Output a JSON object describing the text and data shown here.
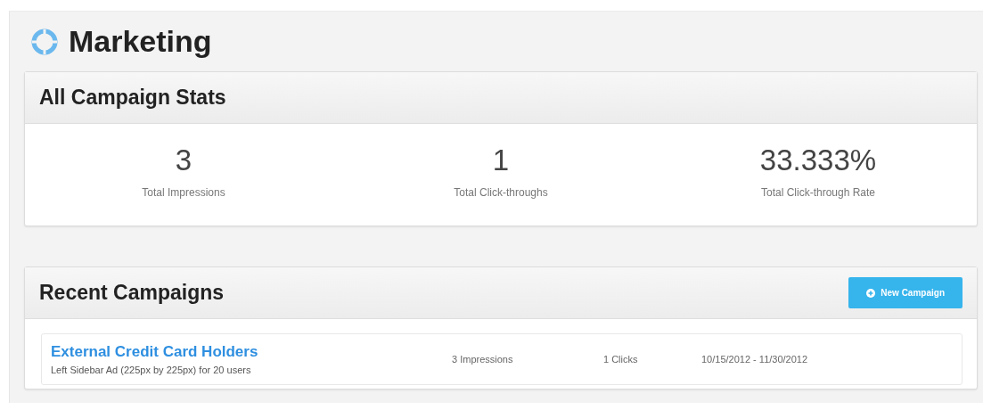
{
  "page": {
    "title": "Marketing"
  },
  "stats_panel": {
    "title": "All Campaign Stats",
    "stats": [
      {
        "value": "3",
        "label": "Total Impressions"
      },
      {
        "value": "1",
        "label": "Total Click-throughs"
      },
      {
        "value": "33.333%",
        "label": "Total Click-through Rate"
      }
    ]
  },
  "campaigns_panel": {
    "title": "Recent Campaigns",
    "button": "New Campaign",
    "rows": [
      {
        "name": "External Credit Card Holders",
        "description": "Left Sidebar Ad (225px by 225px) for 20 users",
        "impressions": "3 Impressions",
        "clicks": "1 Clicks",
        "dates": "10/15/2012 - 11/30/2012"
      }
    ]
  }
}
